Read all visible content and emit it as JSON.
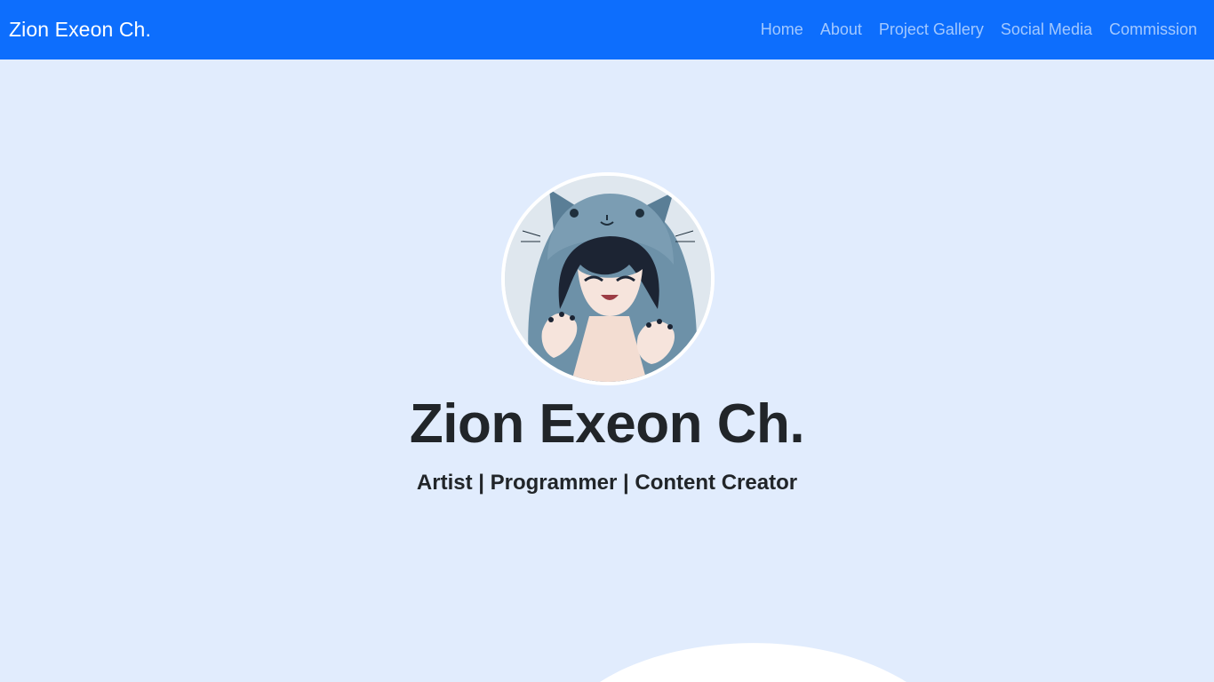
{
  "navbar": {
    "brand": "Zion Exeon Ch.",
    "links": [
      {
        "label": "Home"
      },
      {
        "label": "About"
      },
      {
        "label": "Project Gallery"
      },
      {
        "label": "Social Media"
      },
      {
        "label": "Commission"
      }
    ]
  },
  "hero": {
    "title": "Zion Exeon Ch.",
    "subtitle": "Artist | Programmer | Content Creator",
    "avatar_icon": "anime-cat-hood-avatar"
  },
  "colors": {
    "navbar_bg": "#0d6efd",
    "page_bg": "#e1ecfd",
    "text": "#212529",
    "wave": "#ffffff"
  }
}
